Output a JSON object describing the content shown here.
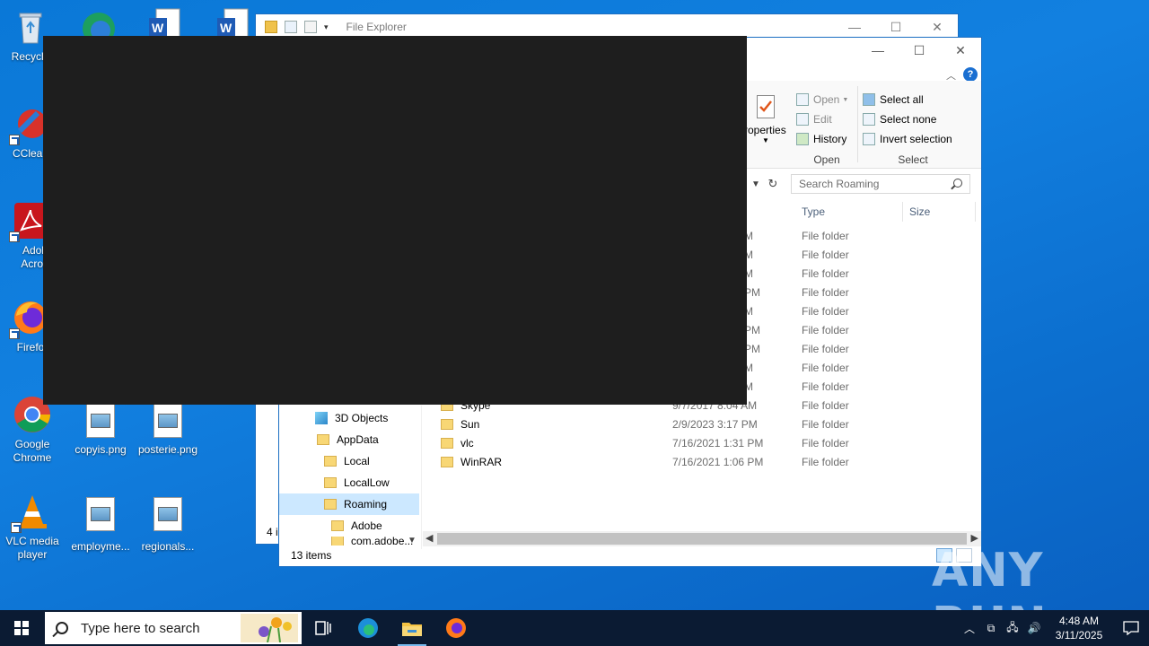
{
  "desktop": {
    "icons": [
      {
        "label": "Recycle"
      },
      {
        "label": "CClean"
      },
      {
        "label": "Adob Acrob"
      },
      {
        "label": "Firefo"
      },
      {
        "label": "Google Chrome"
      },
      {
        "label": "VLC media player"
      },
      {
        "label": "copyis.png"
      },
      {
        "label": "posterie.png"
      },
      {
        "label": "employme..."
      },
      {
        "label": "regionals..."
      }
    ]
  },
  "back_window": {
    "title": "File Explorer",
    "nav": [
      {
        "label": "3D Objects"
      },
      {
        "label": "AppData"
      },
      {
        "label": "Local"
      },
      {
        "label": "LocalLow"
      },
      {
        "label": "Roaming"
      },
      {
        "label": "Adobe"
      }
    ],
    "status": "4 i"
  },
  "front_window": {
    "ribbon": {
      "properties_label": "roperties",
      "open_group": {
        "label": "Open",
        "items": [
          {
            "label": "Open",
            "icon": "open-icon"
          },
          {
            "label": "Edit",
            "icon": "edit-icon"
          },
          {
            "label": "History",
            "icon": "history-icon"
          }
        ]
      },
      "select_group": {
        "label": "Select",
        "items": [
          {
            "label": "Select all",
            "icon": "select-all-icon"
          },
          {
            "label": "Select none",
            "icon": "select-none-icon"
          },
          {
            "label": "Invert selection",
            "icon": "invert-selection-icon"
          }
        ]
      }
    },
    "search": {
      "placeholder": "Search Roaming"
    },
    "columns": {
      "type": "Type",
      "size": "Size"
    },
    "partial_rows": [
      {
        "date_tail": "M",
        "type": "File folder"
      },
      {
        "date_tail": "M",
        "type": "File folder"
      },
      {
        "date_tail": "M",
        "type": "File folder"
      },
      {
        "date_tail": "PM",
        "type": "File folder"
      },
      {
        "date_tail": "M",
        "type": "File folder"
      },
      {
        "date_tail": "PM",
        "type": "File folder"
      },
      {
        "date_tail": "PM",
        "type": "File folder"
      },
      {
        "date_tail": "M",
        "type": "File folder"
      },
      {
        "date_tail": "M",
        "type": "File folder"
      }
    ],
    "files": [
      {
        "name": "Skype",
        "date": "9/7/2017 8:04 AM",
        "type": "File folder"
      },
      {
        "name": "Sun",
        "date": "2/9/2023 3:17 PM",
        "type": "File folder"
      },
      {
        "name": "vlc",
        "date": "7/16/2021 1:31 PM",
        "type": "File folder"
      },
      {
        "name": "WinRAR",
        "date": "7/16/2021 1:06 PM",
        "type": "File folder"
      }
    ],
    "nav": [
      {
        "label": "3D Objects",
        "indent": 1
      },
      {
        "label": "AppData",
        "indent": 0
      },
      {
        "label": "Local",
        "indent": 1
      },
      {
        "label": "LocalLow",
        "indent": 1
      },
      {
        "label": "Roaming",
        "indent": 1,
        "selected": true
      },
      {
        "label": "Adobe",
        "indent": 2
      },
      {
        "label": "com.adobe...",
        "indent": 2
      }
    ],
    "status": "13 items"
  },
  "taskbar": {
    "search_placeholder": "Type here to search",
    "time": "4:48 AM",
    "date": "3/11/2025"
  },
  "watermark": "ANY RUN",
  "colors": {
    "accent": "#1b6ec2",
    "selection": "#cce8ff",
    "taskbar": "#0b1b33"
  }
}
